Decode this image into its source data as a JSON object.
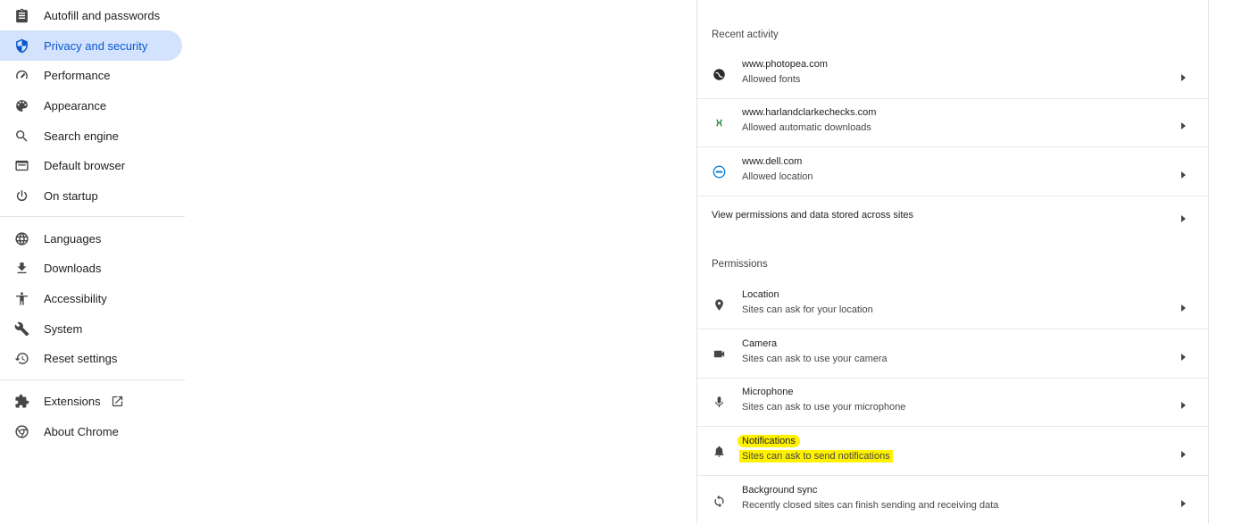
{
  "sidebar": {
    "items": [
      {
        "label": "Autofill and passwords",
        "icon": "clipboard-icon"
      },
      {
        "label": "Privacy and security",
        "icon": "shield-icon",
        "active": true
      },
      {
        "label": "Performance",
        "icon": "speedometer-icon"
      },
      {
        "label": "Appearance",
        "icon": "palette-icon"
      },
      {
        "label": "Search engine",
        "icon": "search-icon"
      },
      {
        "label": "Default browser",
        "icon": "browser-window-icon"
      },
      {
        "label": "On startup",
        "icon": "power-icon"
      },
      {
        "label": "Languages",
        "icon": "globe-icon"
      },
      {
        "label": "Downloads",
        "icon": "download-icon"
      },
      {
        "label": "Accessibility",
        "icon": "accessibility-icon"
      },
      {
        "label": "System",
        "icon": "wrench-icon"
      },
      {
        "label": "Reset settings",
        "icon": "history-icon"
      },
      {
        "label": "Extensions",
        "icon": "puzzle-icon"
      },
      {
        "label": "About Chrome",
        "icon": "chrome-icon"
      }
    ]
  },
  "recent_activity": {
    "title": "Recent activity",
    "items": [
      {
        "site": "www.photopea.com",
        "detail": "Allowed fonts",
        "icon": "photopea-favicon"
      },
      {
        "site": "www.harlandclarkechecks.com",
        "detail": "Allowed automatic downloads",
        "icon": "harlandclarke-favicon"
      },
      {
        "site": "www.dell.com",
        "detail": "Allowed location",
        "icon": "dell-favicon"
      }
    ],
    "view_all": "View permissions and data stored across sites"
  },
  "permissions": {
    "title": "Permissions",
    "items": [
      {
        "name": "Location",
        "detail": "Sites can ask for your location",
        "icon": "location-pin-icon"
      },
      {
        "name": "Camera",
        "detail": "Sites can ask to use your camera",
        "icon": "camera-icon"
      },
      {
        "name": "Microphone",
        "detail": "Sites can ask to use your microphone",
        "icon": "microphone-icon"
      },
      {
        "name": "Notifications",
        "detail": "Sites can ask to send notifications",
        "icon": "bell-icon",
        "highlighted": true
      },
      {
        "name": "Background sync",
        "detail": "Recently closed sites can finish sending and receiving data",
        "icon": "sync-icon"
      }
    ]
  },
  "colors": {
    "accent": "#0b57d0",
    "active_bg": "#d3e3fd",
    "highlight": "#fff200"
  }
}
